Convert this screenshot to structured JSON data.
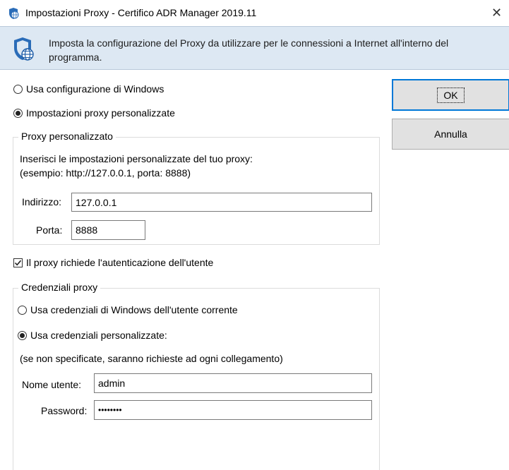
{
  "window": {
    "title": "Impostazioni Proxy - Certifico ADR Manager 2019.11",
    "close_symbol": "✕",
    "icon": "globe-settings-icon"
  },
  "header": {
    "icon": "shield-globe-icon",
    "text": "Imposta la configurazione del Proxy da utilizzare per le connessioni a Internet all'interno del programma."
  },
  "proxy_mode": {
    "option_windows": "Usa configurazione di Windows",
    "option_custom": "Impostazioni proxy personalizzate",
    "selected": "custom"
  },
  "custom_proxy": {
    "group_title": "Proxy personalizzato",
    "hint_line1": "Inserisci le impostazioni personalizzate del tuo proxy:",
    "hint_line2": "(esempio: http://127.0.0.1, porta: 8888)",
    "address_label": "Indirizzo:",
    "address_value": "127.0.0.1",
    "port_label": "Porta:",
    "port_value": "8888"
  },
  "auth": {
    "checkbox_label": "Il proxy richiede l'autenticazione dell'utente",
    "checked": true
  },
  "credentials": {
    "group_title": "Credenziali proxy",
    "option_windows": "Usa credenziali di Windows dell'utente corrente",
    "option_custom": "Usa credenziali personalizzate:",
    "selected": "custom",
    "note": "(se non specificate, saranno richieste ad ogni collegamento)",
    "username_label": "Nome utente:",
    "username_value": "admin",
    "password_label": "Password:",
    "password_value": "••••••••"
  },
  "buttons": {
    "ok_label": "OK",
    "cancel_label": "Annulla"
  },
  "colors": {
    "header_bg": "#dde8f3",
    "accent": "#0078d7",
    "button_bg": "#e1e1e1"
  }
}
